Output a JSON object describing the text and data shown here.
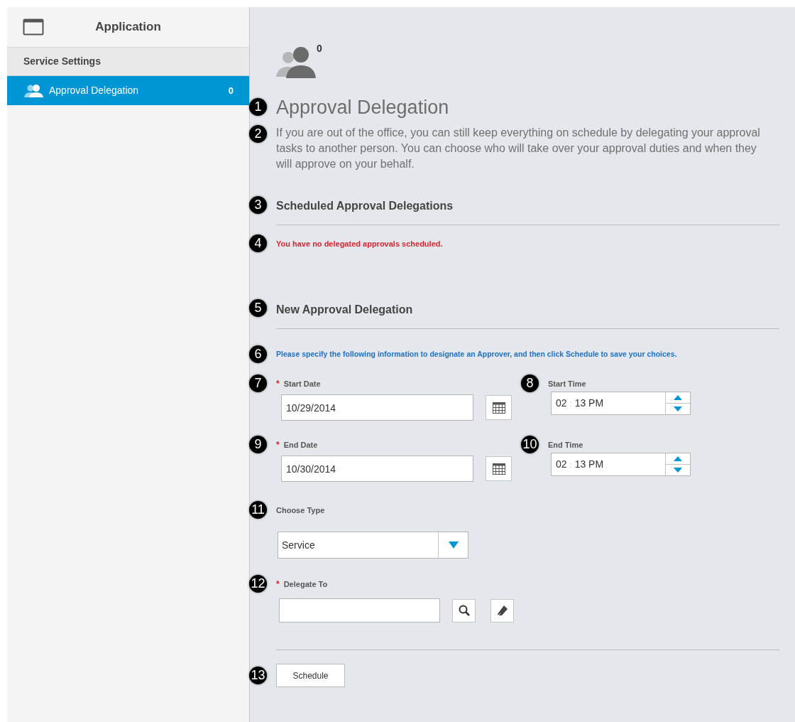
{
  "sidebar": {
    "title": "Application",
    "section": "Service Settings",
    "items": [
      {
        "label": "Approval Delegation",
        "count": "0",
        "selected": true
      }
    ]
  },
  "main": {
    "count": "0",
    "title": {
      "callout": "1",
      "text": "Approval Delegation"
    },
    "description": {
      "callout": "2",
      "text": "If you are out of the office, you can still keep everything on schedule by delegating your approval tasks to another person. You can choose who will take over your approval duties and when they will approve on your behalf."
    },
    "scheduled": {
      "callout": "3",
      "heading": "Scheduled Approval Delegations",
      "message_callout": "4",
      "message": "You have no delegated approvals scheduled."
    },
    "new": {
      "callout": "5",
      "heading": "New Approval Delegation",
      "hint_callout": "6",
      "hint": "Please specify the following information to designate an Approver, and then click Schedule to save your choices."
    },
    "date_rows": [
      {
        "date": {
          "callout": "7",
          "required_mark": "*",
          "label": "Start Date",
          "value": "10/29/2014"
        },
        "time": {
          "callout": "8",
          "label": "Start Time",
          "hours": "02",
          "separator": ":",
          "rest": "13 PM"
        }
      },
      {
        "date": {
          "callout": "9",
          "required_mark": "*",
          "label": "End Date",
          "value": "10/30/2014"
        },
        "time": {
          "callout": "10",
          "label": "End Time",
          "hours": "02",
          "separator": ":",
          "rest": "13 PM"
        }
      }
    ],
    "type": {
      "callout": "11",
      "label": "Choose Type",
      "value": "Service"
    },
    "delegate": {
      "callout": "12",
      "required_mark": "*",
      "label": "Delegate To"
    },
    "schedule": {
      "callout": "13",
      "label": "Schedule"
    }
  }
}
